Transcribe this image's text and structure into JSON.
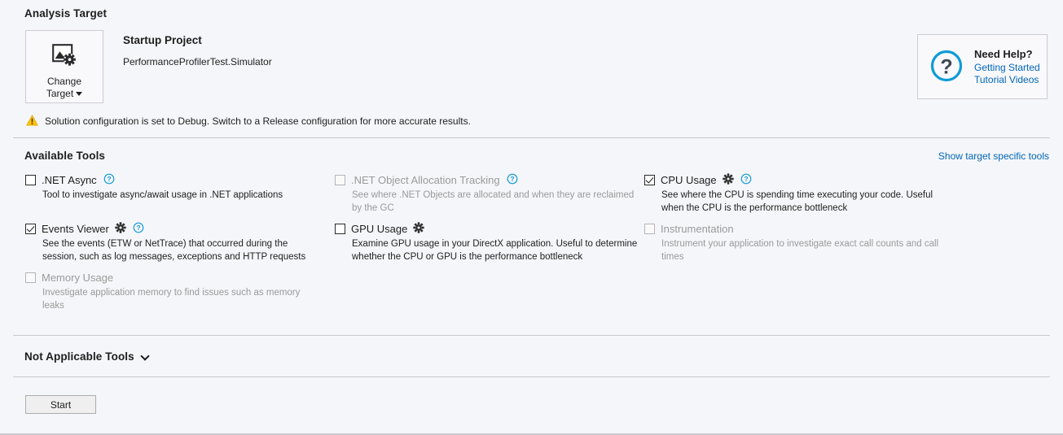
{
  "analysis_target": {
    "section_title": "Analysis Target",
    "change_target_button": {
      "line1": "Change",
      "line2": "Target",
      "icon": "image-gear-icon"
    },
    "startup_project_title": "Startup Project",
    "startup_project_name": "PerformanceProfilerTest.Simulator",
    "warning": {
      "icon": "warning-triangle-icon",
      "text": "Solution configuration is set to Debug. Switch to a Release configuration for more accurate results."
    }
  },
  "need_help": {
    "icon": "question-circle-icon",
    "title": "Need Help?",
    "links": [
      {
        "label": "Getting Started"
      },
      {
        "label": "Tutorial Videos"
      }
    ]
  },
  "available_tools": {
    "section_title": "Available Tools",
    "show_target_specific_tools": "Show target specific tools",
    "tools": [
      {
        "id": "net-async",
        "name": ".NET Async",
        "description": "Tool to investigate async/await usage in .NET applications",
        "checked": false,
        "enabled": true,
        "has_settings": false,
        "has_help": true
      },
      {
        "id": "events-viewer",
        "name": "Events Viewer",
        "description": "See the events (ETW or NetTrace) that occurred during the session, such as log messages, exceptions and HTTP requests",
        "checked": true,
        "enabled": true,
        "has_settings": true,
        "has_help": true
      },
      {
        "id": "memory-usage",
        "name": "Memory Usage",
        "description": "Investigate application memory to find issues such as memory leaks",
        "checked": false,
        "enabled": false,
        "has_settings": false,
        "has_help": false
      },
      {
        "id": "net-object-allocation-tracking",
        "name": ".NET Object Allocation Tracking",
        "description": "See where .NET Objects are allocated and when they are reclaimed by the GC",
        "checked": false,
        "enabled": false,
        "has_settings": false,
        "has_help": true
      },
      {
        "id": "gpu-usage",
        "name": "GPU Usage",
        "description": "Examine GPU usage in your DirectX application. Useful to determine whether the CPU or GPU is the performance bottleneck",
        "checked": false,
        "enabled": true,
        "has_settings": true,
        "has_help": false
      },
      {
        "id": "cpu-usage",
        "name": "CPU Usage",
        "description": "See where the CPU is spending time executing your code. Useful when the CPU is the performance bottleneck",
        "checked": true,
        "enabled": true,
        "has_settings": true,
        "has_help": true
      },
      {
        "id": "instrumentation",
        "name": "Instrumentation",
        "description": "Instrument your application to investigate exact call counts and call times",
        "checked": false,
        "enabled": false,
        "has_settings": false,
        "has_help": false
      }
    ]
  },
  "not_applicable_tools": {
    "label": "Not Applicable Tools",
    "expanded": false
  },
  "footer": {
    "start_label": "Start"
  },
  "colors": {
    "background": "#f5f6fa",
    "link": "#0065b8",
    "help_icon": "#0f9bd7",
    "warning": "#ffc20e",
    "divider": "#c8c8cd",
    "disabled_text": "#9a9a9a"
  }
}
